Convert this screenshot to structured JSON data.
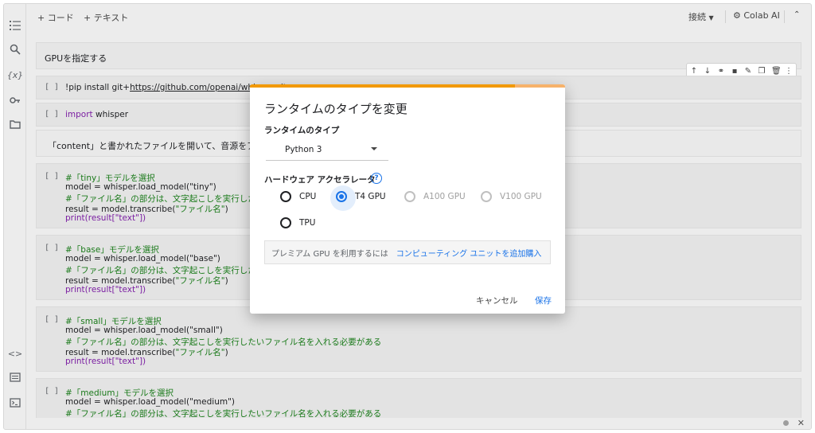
{
  "toolbar": {
    "add_code": "+ コード",
    "add_text": "+ テキスト",
    "connect": "接続",
    "colab_ai": "Colab AI"
  },
  "cells": {
    "heading": "GPUを指定する",
    "pip": {
      "bracket": "[ ]",
      "cmd": "!pip install git+",
      "url": "https://github.com/openai/whisper.git"
    },
    "import": {
      "bracket": "[ ]",
      "kw": "import",
      "rest": " whisper"
    },
    "content_text": "「content」と書かれたファイルを開いて、音源をア",
    "tiny": {
      "bracket": "[ ]",
      "l1": "#「tiny」モデルを選択",
      "l2": "model = whisper.load_model(\"tiny\")",
      "l3": "#「ファイル名」の部分は、文字起こしを実行したいファイル",
      "l4a": "result = model.transcribe(",
      "l4b": "\"ファイル名\"",
      "l4c": ")",
      "l5": "print(result[\"text\"])"
    },
    "base": {
      "bracket": "[ ]",
      "l1": "#「base」モデルを選択",
      "l2": "model = whisper.load_model(\"base\")",
      "l3": "#「ファイル名」の部分は、文字起こしを実行したいファイル",
      "l4a": "result = model.transcribe(",
      "l4b": "\"ファイル名\"",
      "l4c": ")",
      "l5": "print(result[\"text\"])"
    },
    "small": {
      "bracket": "[ ]",
      "l1": "#「small」モデルを選択",
      "l2": "model = whisper.load_model(\"small\")",
      "l3": "#「ファイル名」の部分は、文字起こしを実行したいファイル名を入れる必要がある",
      "l4a": "result = model.transcribe(",
      "l4b": "\"ファイル名\"",
      "l4c": ")",
      "l5": "print(result[\"text\"])"
    },
    "medium": {
      "bracket": "[ ]",
      "l1": "#「medium」モデルを選択",
      "l2": "model = whisper.load_model(\"medium\")",
      "l3": "#「ファイル名」の部分は、文字起こしを実行したいファイル名を入れる必要がある"
    }
  },
  "dialog": {
    "title": "ランタイムのタイプを変更",
    "runtime_label": "ランタイムのタイプ",
    "runtime_value": "Python 3",
    "hw_label": "ハードウェア アクセラレータ",
    "help": "?",
    "progress": 0.84,
    "options": [
      {
        "label": "CPU",
        "checked": false,
        "disabled": false
      },
      {
        "label": "T4 GPU",
        "checked": true,
        "disabled": false
      },
      {
        "label": "A100 GPU",
        "checked": false,
        "disabled": true
      },
      {
        "label": "V100 GPU",
        "checked": false,
        "disabled": true
      },
      {
        "label": "TPU",
        "checked": false,
        "disabled": false
      }
    ],
    "premium_text": "プレミアム GPU を利用するには",
    "premium_link": "コンピューティング ユニットを追加購入",
    "cancel": "キャンセル",
    "save": "保存"
  },
  "colors": {
    "accent": "#1a73e8",
    "progress": "#f29900",
    "comment": "#1a7a1a",
    "keyword": "#7b1fa2"
  },
  "icons": [
    "toc-icon",
    "search-icon",
    "variables-icon",
    "key-icon",
    "folder-icon",
    "code-snippets-icon",
    "command-palette-icon",
    "terminal-icon"
  ]
}
